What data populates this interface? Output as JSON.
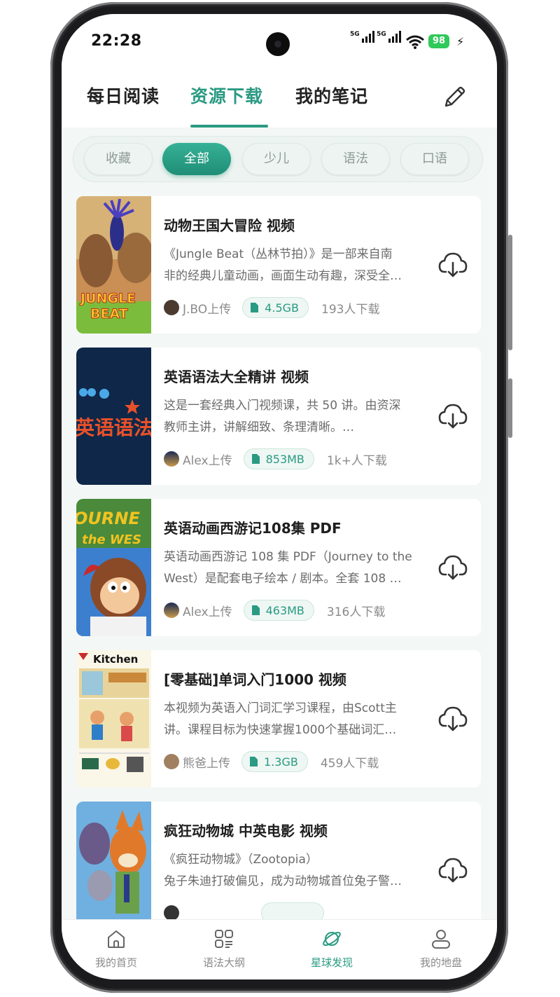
{
  "status_bar": {
    "time": "22:28",
    "signal1": "5G",
    "signal2": "5G",
    "battery": "98"
  },
  "top_tabs": [
    "每日阅读",
    "资源下载",
    "我的笔记"
  ],
  "active_tab": "资源下载",
  "filters": [
    "收藏",
    "全部",
    "少儿",
    "语法",
    "口语"
  ],
  "active_filter": "全部",
  "resources": [
    {
      "title": "动物王国大冒险 视频",
      "desc_line1": "《Jungle Beat（丛林节拍）》是一部来自南",
      "desc_line2": "非的经典儿童动画，画面生动有趣，深受全…",
      "uploader": "J.BO上传",
      "size": "4.5GB",
      "downloads": "193人下载",
      "thumb_text": "JUNGLE BEAT"
    },
    {
      "title": "英语语法大全精讲 视频",
      "desc_line1": "这是一套经典入门视频课，共 50 讲。由资深",
      "desc_line2": "教师主讲，讲解细致、条理清晰。…",
      "uploader": "Alex上传",
      "size": "853MB",
      "downloads": "1k+人下载",
      "thumb_text": "英语语法"
    },
    {
      "title": "英语动画西游记108集 PDF",
      "desc_line1": "英语动画西游记 108 集 PDF（Journey to the",
      "desc_line2": "West）是配套电子绘本 / 剧本。全套 108 …",
      "uploader": "Alex上传",
      "size": "463MB",
      "downloads": "316人下载",
      "thumb_text": "OURNEY the WES"
    },
    {
      "title": "[零基础]单词入门1000 视频",
      "desc_line1": "本视频为英语入门词汇学习课程，由Scott主",
      "desc_line2": "讲。课程目标为快速掌握1000个基础词汇…",
      "uploader": "熊爸上传",
      "size": "1.3GB",
      "downloads": "459人下载",
      "thumb_text": "Kitchen"
    },
    {
      "title": "疯狂动物城 中英电影 视频",
      "desc_line1": "《疯狂动物城》（Zootopia）",
      "desc_line2": "兔子朱迪打破偏见，成为动物城首位兔子警…",
      "uploader": "",
      "size": "",
      "downloads": "",
      "thumb_text": ""
    }
  ],
  "bottom_nav": [
    "我的首页",
    "语法大纲",
    "星球发现",
    "我的地盘"
  ],
  "active_nav": "星球发现",
  "colors": {
    "accent": "#2a9a82",
    "background": "#f3f7f5"
  }
}
